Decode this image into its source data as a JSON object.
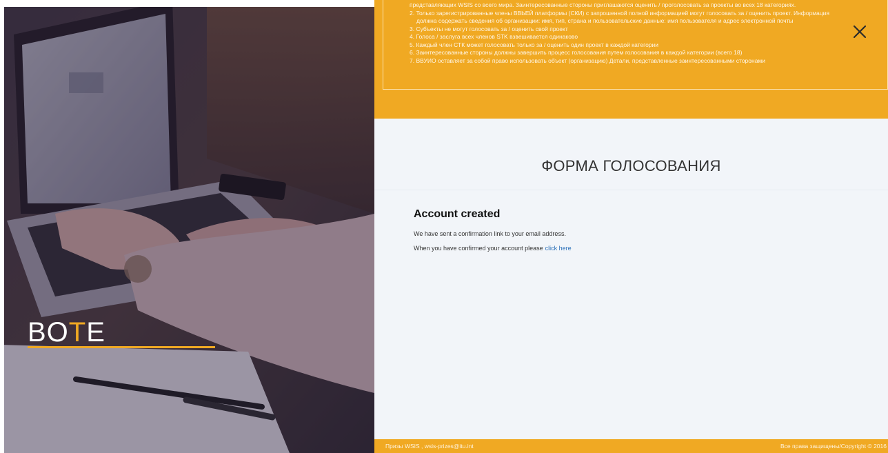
{
  "brand": {
    "prefix": "BO",
    "accent": "T",
    "suffix": "E"
  },
  "rules": [
    "представляющих WSIS со всего мира. Заинтересованные стороны приглашаются оценить / проголосовать за проекты во всех 18 категориях.",
    "2. Только зарегистрированные члены ВВЬЕЙ платформы (СКИ) с запрошенной полной информацией могут голосовать за / оценить проект. Информация",
    "должна содержать сведения об организации: имя, тип, страна и пользовательские данные: имя пользователя и адрес электронной почты",
    "3. Субъекты не могут голосовать за / оценить свой проект",
    "4. Голоса / заслуга всех членов STK взвешивается одинаково",
    "5. Каждый член СТК может голосовать только за / оценить один проект в каждой категории",
    "6. Заинтересованные стороны должны завершить процесс голосования путем голосования в каждой категории (всего 18)",
    "7. ВВУИО оставляет за собой право использовать объект (организацию) Детали, представленные заинтересованными сторонами"
  ],
  "form": {
    "title": "ФОРМА ГОЛОСОВАНИЯ",
    "heading": "Account created",
    "message1": "We have sent a confirmation link to your email address.",
    "message2": "When you have confirmed your account please",
    "link": "click here"
  },
  "footer": {
    "left": "Призы WSIS , wsis-prizes@itu.int",
    "right": "Все права защищены/Copyright © 2016"
  },
  "colors": {
    "accent": "#f0a923",
    "link": "#2a6fb8",
    "panel": "#f2f5f9"
  },
  "icons": {
    "close": "close-icon"
  }
}
